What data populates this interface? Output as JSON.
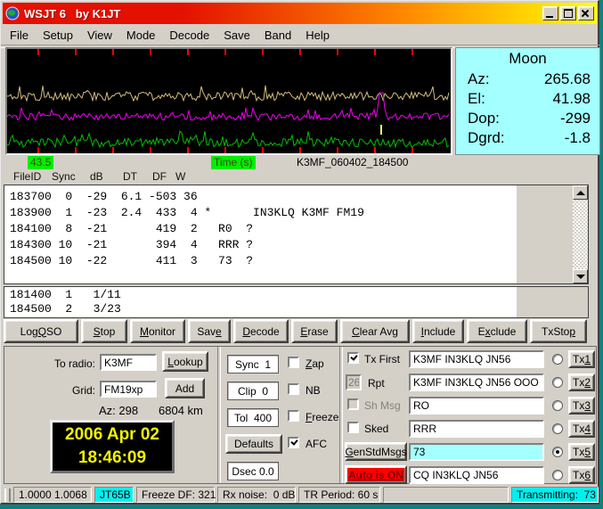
{
  "window": {
    "title": "WSJT 6   by K1JT"
  },
  "menu": {
    "items": [
      {
        "label": "File"
      },
      {
        "label": "Setup"
      },
      {
        "label": "View"
      },
      {
        "label": "Mode"
      },
      {
        "label": "Decode"
      },
      {
        "label": "Save"
      },
      {
        "label": "Band"
      },
      {
        "label": "Help"
      }
    ]
  },
  "plot": {
    "freq_label": "43.5",
    "axis_label": "Time (s)",
    "file_label": "K3MF_060402_184500",
    "colors": {
      "background": "#000000",
      "tick": "#ff0000",
      "trace_top": "#d2bc7c",
      "trace_mid": "#ee00ee",
      "trace_bottom": "#00c000",
      "marker": "#ffff80"
    }
  },
  "moon": {
    "title": "Moon",
    "rows": [
      {
        "label": "Az:",
        "value": "265.68"
      },
      {
        "label": "El:",
        "value": "41.98"
      },
      {
        "label": "Dop:",
        "value": "-299"
      },
      {
        "label": "Dgrd:",
        "value": "-1.8"
      }
    ]
  },
  "decode": {
    "headers": [
      {
        "label": "FileID"
      },
      {
        "label": "Sync"
      },
      {
        "label": "dB"
      },
      {
        "label": "DT"
      },
      {
        "label": "DF"
      },
      {
        "label": "W"
      }
    ],
    "lines": [
      "183700  0  -29  6.1 -503 36",
      "183900  1  -23  2.4  433  4 *      IN3KLQ K3MF FM19",
      "184100  8  -21       419  2   R0  ?",
      "184300 10  -21       394  4   RRR ?",
      "184500 10  -22       411  3   73  ?"
    ],
    "avg_lines": [
      "181400  1   1/11",
      "184500  2   3/23"
    ]
  },
  "toolbar": {
    "buttons": [
      {
        "label": "Log QSO",
        "accel": 4
      },
      {
        "label": "Stop",
        "accel": 0
      },
      {
        "label": "Monitor",
        "accel": 0
      },
      {
        "label": "Save",
        "accel": 3
      },
      {
        "label": "Decode",
        "accel": 0
      },
      {
        "label": "Erase",
        "accel": 0
      },
      {
        "label": "Clear Avg",
        "accel": 0
      },
      {
        "label": "Include",
        "accel": 0
      },
      {
        "label": "Exclude",
        "accel": 1
      },
      {
        "label": "TxStop",
        "accel": 5
      }
    ]
  },
  "station": {
    "to_radio_label": "To radio:",
    "to_radio_value": "K3MF",
    "grid_label": "Grid:",
    "grid_value": "FM19xp",
    "lookup_label": "Lookup",
    "lookup_accel": 0,
    "add_label": "Add",
    "azimuth": "Az: 298",
    "distance": "6804 km"
  },
  "clock": {
    "date": "2006 Apr 02",
    "time": "18:46:09"
  },
  "params": {
    "sync_text": "Sync  1",
    "clip_text": "Clip  0",
    "tol_text": "Tol  400",
    "defaults_label": "Defaults",
    "dsec_text": "Dsec 0.0",
    "checkboxes": [
      {
        "label": "Zap",
        "accel": 0,
        "checked": false
      },
      {
        "label": "NB",
        "checked": false
      },
      {
        "label": "Freeze",
        "accel": 0,
        "checked": false
      },
      {
        "label": "AFC",
        "checked": true
      }
    ]
  },
  "tx": {
    "tx_first_label": "Tx First",
    "tx_first_checked": true,
    "rpt_value": "26",
    "rpt_label": "Rpt",
    "sh_msg_label": "Sh Msg",
    "sked_label": "Sked",
    "gen_label": "GenStdMsgs",
    "gen_accel": 0,
    "auto_label": "Auto is ON",
    "messages": [
      {
        "value": "K3MF IN3KLQ JN56",
        "button": "Tx1",
        "accel": 2,
        "selected": false
      },
      {
        "value": "K3MF IN3KLQ JN56 OOO",
        "button": "Tx2",
        "accel": 2,
        "selected": false
      },
      {
        "value": "RO",
        "button": "Tx3",
        "accel": 2,
        "selected": false
      },
      {
        "value": "RRR",
        "button": "Tx4",
        "accel": 2,
        "selected": false
      },
      {
        "value": "73",
        "button": "Tx5",
        "accel": 2,
        "selected": true
      },
      {
        "value": "CQ IN3KLQ JN56",
        "button": "Tx6",
        "accel": 2,
        "selected": false
      }
    ]
  },
  "status": {
    "segments": [
      {
        "text": "1.0000 1.0068"
      },
      {
        "text": "JT65B",
        "highlight": true
      },
      {
        "text": "Freeze DF: 321"
      },
      {
        "text": "Rx noise:  0 dB"
      },
      {
        "text": "TR Period: 60 s"
      },
      {
        "text": "Transmitting:  73",
        "highlight": true
      }
    ]
  }
}
